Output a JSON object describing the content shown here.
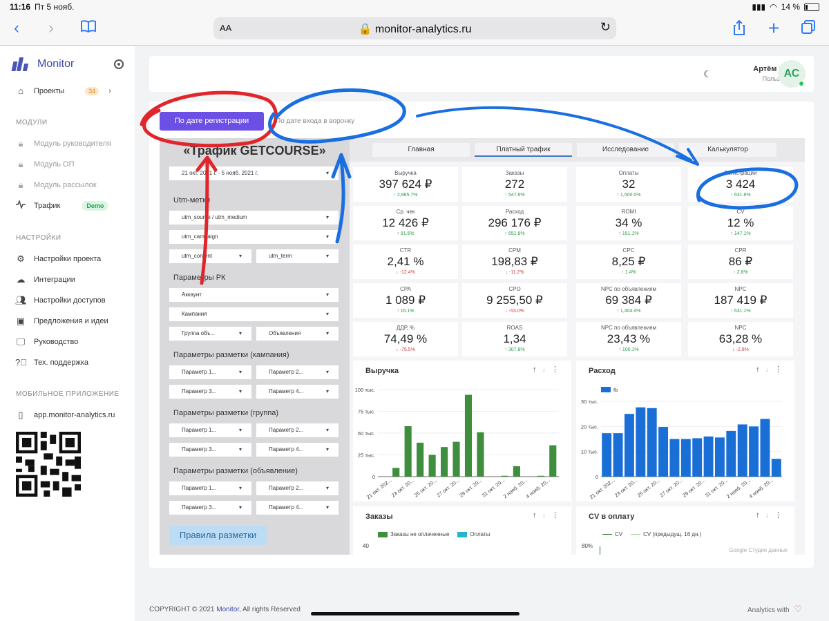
{
  "statusbar": {
    "time": "11:16",
    "date": "Пт 5 нояб.",
    "battery": "14 %"
  },
  "browser": {
    "text_size": "AA",
    "url": "monitor-analytics.ru"
  },
  "sidebar": {
    "brand": "Monitor",
    "projects": {
      "label": "Проекты",
      "count": "34"
    },
    "modules_heading": "МОДУЛИ",
    "modules": [
      {
        "label": "Модуль руководителя",
        "icon": "lock-icon"
      },
      {
        "label": "Модуль ОП",
        "icon": "lock-icon"
      },
      {
        "label": "Модуль рассылок",
        "icon": "lock-icon"
      },
      {
        "label": "Трафик",
        "icon": "activity-icon",
        "badge": "Demo"
      }
    ],
    "settings_heading": "НАСТРОЙКИ",
    "settings": [
      {
        "label": "Настройки проекта",
        "icon": "gear-icon"
      },
      {
        "label": "Интеграции",
        "icon": "cloud-icon"
      },
      {
        "label": "Настройки доступов",
        "icon": "users-icon"
      },
      {
        "label": "Предложения и идеи",
        "icon": "idea-board-icon"
      },
      {
        "label": "Руководство",
        "icon": "monitor-icon"
      },
      {
        "label": "Тех. поддержка",
        "icon": "help-icon"
      }
    ],
    "mobile_heading": "МОБИЛЬНОЕ ПРИЛОЖЕНИЕ",
    "mobile_link": "app.monitor-analytics.ru"
  },
  "header": {
    "user_name": "Артём Седов",
    "user_role": "Пользователь",
    "avatar_initials": "АС"
  },
  "date_toggle": {
    "active": "По дате регистрации",
    "inactive": "По дате входа в воронку"
  },
  "report": {
    "title": "«Трафик GETCOURSE»",
    "date_range": "21 окт. 2021 г. - 5 нояб. 2021 г.",
    "utm_heading": "Utm-метки",
    "utm_source": "utm_source / utm_medium",
    "utm_campaign": "utm_campaign",
    "utm_content": "utm_content",
    "utm_term": "utm_term",
    "rk_heading": "Параметры РК",
    "account": "Аккаунт",
    "campaign": "Кампания",
    "adgroup": "Группа объ...",
    "ads": "Объявления",
    "markup_campaign_heading": "Параметры разметки (кампания)",
    "markup_group_heading": "Параметры разметки (группа)",
    "markup_ad_heading": "Параметры разметки (объявление)",
    "param1": "Параметр 1...",
    "param2": "Параметр 2...",
    "param3": "Параметр 3...",
    "param4": "Параметр 4...",
    "rules_button": "Правила разметки",
    "tabs": [
      "Главная",
      "Платный трафик",
      "Исследование",
      "Калькулятор"
    ]
  },
  "kpis": [
    {
      "label": "Выручка",
      "value": "397 624 ₽",
      "delta": "2,965.7%",
      "dir": "up"
    },
    {
      "label": "Заказы",
      "value": "272",
      "delta": "547.6%",
      "dir": "up"
    },
    {
      "label": "Оплаты",
      "value": "32",
      "delta": "1,500.0%",
      "dir": "up"
    },
    {
      "label": "Регистрации",
      "value": "3 424",
      "delta": "631.6%",
      "dir": "up"
    },
    {
      "label": "Ср. чек",
      "value": "12 426 ₽",
      "delta": "91.6%",
      "dir": "up"
    },
    {
      "label": "Расход",
      "value": "296 176 ₽",
      "delta": "651.8%",
      "dir": "up"
    },
    {
      "label": "ROMI",
      "value": "34 %",
      "delta": "151.1%",
      "dir": "up"
    },
    {
      "label": "CV",
      "value": "12 %",
      "delta": "147.1%",
      "dir": "up"
    },
    {
      "label": "CTR",
      "value": "2,41 %",
      "delta": "-12.4%",
      "dir": "down"
    },
    {
      "label": "CPM",
      "value": "198,83 ₽",
      "delta": "-11.2%",
      "dir": "down"
    },
    {
      "label": "CPC",
      "value": "8,25 ₽",
      "delta": "1.4%",
      "dir": "up"
    },
    {
      "label": "CPR",
      "value": "86 ₽",
      "delta": "2.8%",
      "dir": "up"
    },
    {
      "label": "CPA",
      "value": "1 089 ₽",
      "delta": "16.1%",
      "dir": "up"
    },
    {
      "label": "CPO",
      "value": "9 255,50 ₽",
      "delta": "-53.0%",
      "dir": "down"
    },
    {
      "label": "NPC по объявлениям",
      "value": "69 384 ₽",
      "delta": "1,404.4%",
      "dir": "up"
    },
    {
      "label": "NPC",
      "value": "187 419 ₽",
      "delta": "631.1%",
      "dir": "up"
    },
    {
      "label": "ДДР, %",
      "value": "74,49 %",
      "delta": "-75.5%",
      "dir": "down"
    },
    {
      "label": "ROAS",
      "value": "1,34",
      "delta": "307.8%",
      "dir": "up"
    },
    {
      "label": "NPC по объявлениям",
      "value": "23,43 %",
      "delta": "100.1%",
      "dir": "up"
    },
    {
      "label": "NPC",
      "value": "63,28 %",
      "delta": "-2.8%",
      "dir": "down"
    }
  ],
  "chart_data": [
    {
      "type": "bar",
      "title": "Выручка",
      "color": "#3e8e3e",
      "y_ticks": [
        "0",
        "25 тыс.",
        "50 тыс.",
        "75 тыс.",
        "100 тыс."
      ],
      "ylim": [
        0,
        100000
      ],
      "x_tick_labels": [
        "21 окт. 202...",
        "23 окт. 20...",
        "25 окт. 20...",
        "27 окт. 20...",
        "29 окт. 20...",
        "31 окт. 20...",
        "2 нояб. 20...",
        "4 нояб. 20..."
      ],
      "values": [
        0,
        10000,
        58000,
        39000,
        25000,
        34000,
        40000,
        94000,
        51000,
        0,
        1000,
        12000,
        0,
        1000,
        36000
      ]
    },
    {
      "type": "bar",
      "title": "Расход",
      "color": "#1a6fd6",
      "legend": [
        "fb"
      ],
      "y_ticks": [
        "0",
        "10 тыс.",
        "20 тыс.",
        "30 тыс."
      ],
      "ylim": [
        0,
        30000
      ],
      "x_tick_labels": [
        "21 окт. 202...",
        "23 окт. 20...",
        "25 окт. 20...",
        "27 окт. 20...",
        "29 окт. 20...",
        "31 окт. 20...",
        "2 нояб. 20...",
        "4 нояб. 20..."
      ],
      "values": [
        17300,
        17300,
        25000,
        27600,
        27300,
        19800,
        15000,
        15000,
        15300,
        16000,
        15600,
        18200,
        20800,
        20000,
        23000,
        7100
      ]
    },
    {
      "type": "bar",
      "title": "Заказы",
      "legend": [
        "Заказы не оплаченные",
        "Оплаты"
      ],
      "legend_colors": [
        "#3e8e3e",
        "#22b5cc"
      ],
      "y_ticks_visible": [
        "40"
      ]
    },
    {
      "type": "line",
      "title": "CV в оплату",
      "legend": [
        "CV",
        "CV (предыдущ. 16 дн.)"
      ],
      "y_ticks_visible": [
        "80%"
      ]
    }
  ],
  "footer": {
    "copyright": "COPYRIGHT © 2021",
    "brand": "Monitor",
    "rights": ", All rights Reserved",
    "right_text": "Analytics with"
  },
  "watermark": "Google Студия данных"
}
